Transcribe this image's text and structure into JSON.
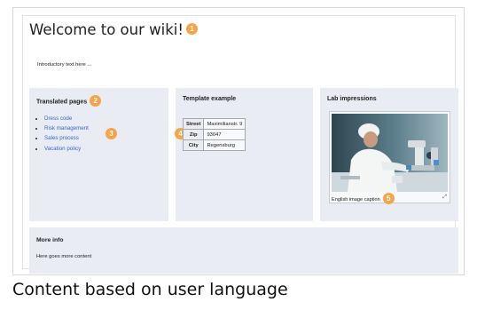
{
  "page": {
    "title": "Welcome to our wiki!",
    "intro": "Introductory text here ...",
    "footer_caption": "Content based on user language"
  },
  "badges": {
    "b1": "1",
    "b2": "2",
    "b3": "3",
    "b4": "4",
    "b5": "5",
    "color": "#f5a547"
  },
  "translated": {
    "title": "Translated pages",
    "items": [
      "Dress code",
      "Risk management",
      "Sales process",
      "Vacation policy"
    ]
  },
  "template": {
    "title": "Template example",
    "rows": [
      {
        "label": "Street",
        "value": "Maximilianstr. 9"
      },
      {
        "label": "Zip",
        "value": "93047"
      },
      {
        "label": "City",
        "value": "Regensburg"
      }
    ]
  },
  "lab": {
    "title": "Lab impressions",
    "caption": "English image caption",
    "enlarge_icon": "enlarge-icon"
  },
  "more": {
    "title": "More info",
    "body": "Here goes more content"
  },
  "colors": {
    "box_bg": "#eaecf4",
    "link": "#3366cc"
  }
}
